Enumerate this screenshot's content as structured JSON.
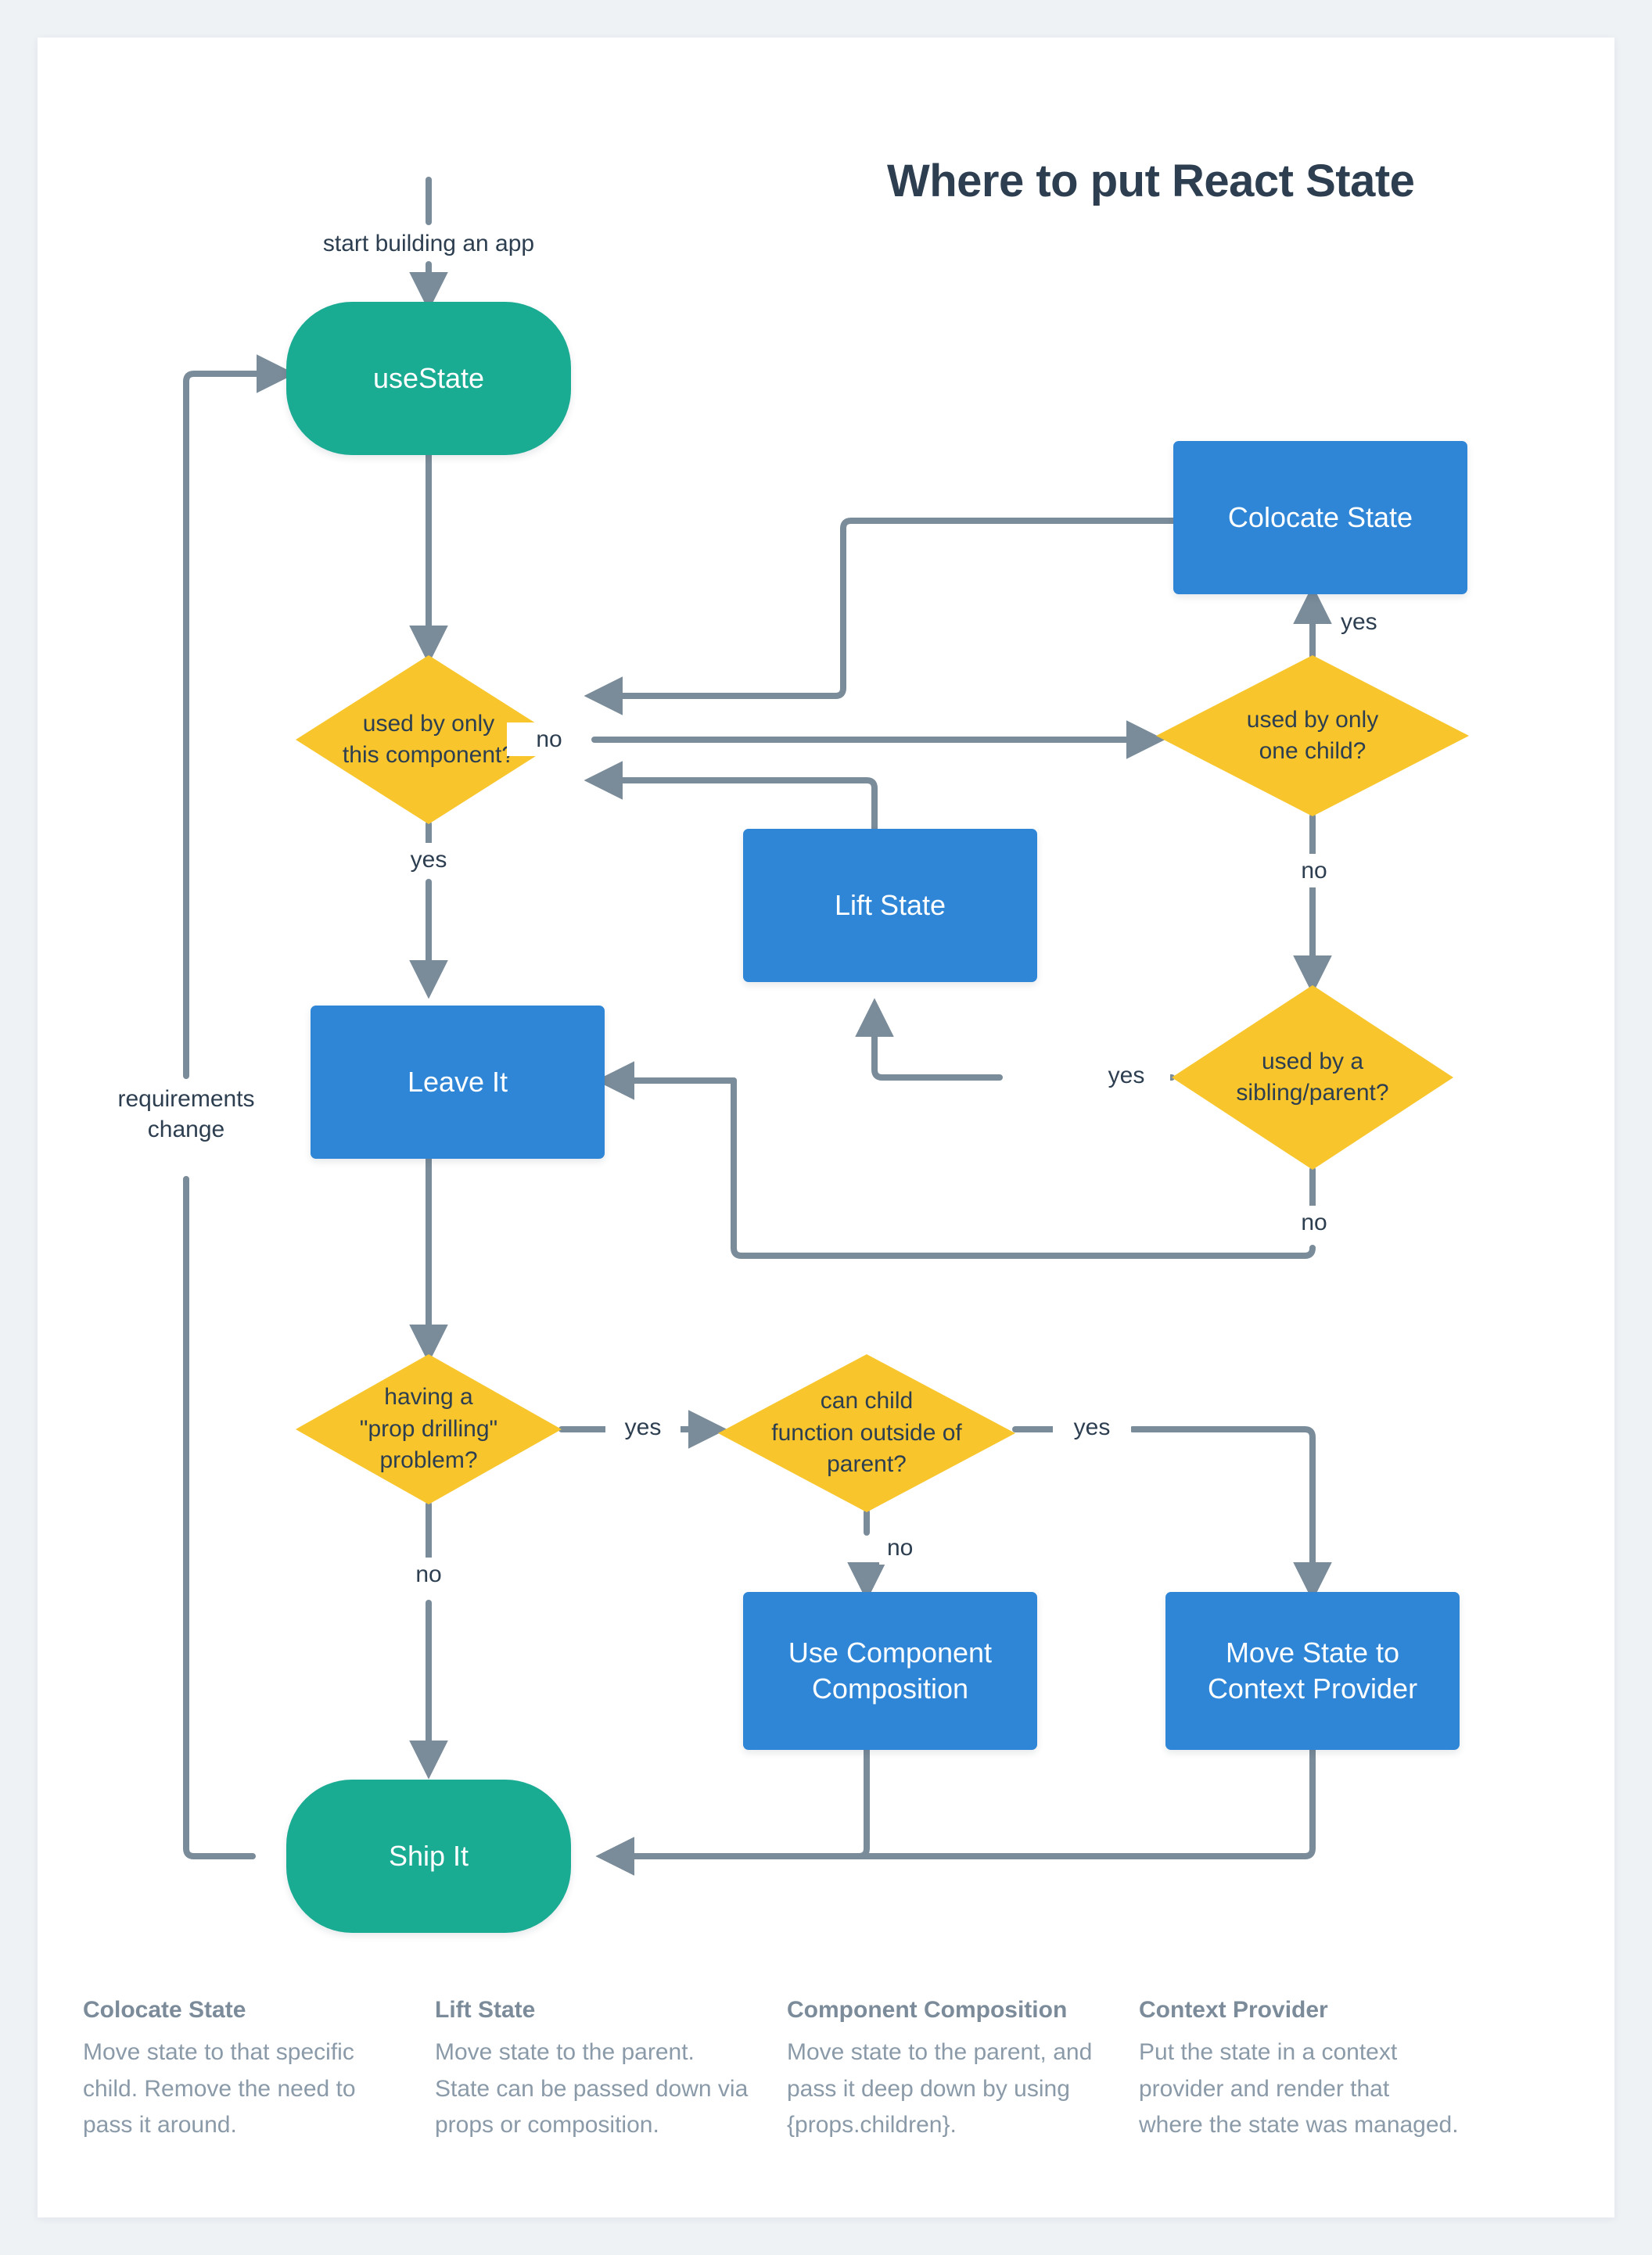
{
  "title": "Where to put React State",
  "colors": {
    "page_background": "#eef2f5",
    "card_background": "#ffffff",
    "terminal_teal": "#1aab93",
    "action_blue": "#2f86d7",
    "decision_yellow": "#f8c62c",
    "edge_gray": "#7a8b99",
    "text_dark": "#2c3e50",
    "legend_gray": "#8a9aa8"
  },
  "nodes": {
    "use_state": "useState",
    "colocate_state": "Colocate State",
    "lift_state": "Lift State",
    "leave_it": "Leave It",
    "use_component_composition": "Use Component\nComposition",
    "move_state_to_context_provider": "Move State to\nContext Provider",
    "ship_it": "Ship It"
  },
  "decisions": {
    "used_by_only_this_component": "used by only\nthis component?",
    "used_by_only_one_child": "used by only\none child?",
    "used_by_a_sibling_parent": "used by a\nsibling/parent?",
    "having_a_prop_drilling_problem": "having a\n\"prop drilling\"\nproblem?",
    "can_child_function_outside_of_parent": "can child\nfunction outside of\nparent?"
  },
  "edge_labels": {
    "start": "start building an app",
    "requirements_change": "requirements\nchange",
    "this_component_no": "no",
    "this_component_yes": "yes",
    "one_child_yes": "yes",
    "one_child_no": "no",
    "sibling_parent_yes": "yes",
    "sibling_parent_no": "no",
    "prop_drilling_yes": "yes",
    "prop_drilling_no": "no",
    "child_outside_yes": "yes",
    "child_outside_no": "no"
  },
  "legend": [
    {
      "title": "Colocate State",
      "body": "Move state to that specific child. Remove the need to pass it around."
    },
    {
      "title": "Lift State",
      "body": "Move state to the parent. State can be passed down via props or composition."
    },
    {
      "title": "Component Composition",
      "body": "Move state to the parent, and pass it deep down by using {props.children}."
    },
    {
      "title": "Context Provider",
      "body": "Put the state in a context provider and render that where the state was managed."
    }
  ],
  "chart_data": {
    "type": "flowchart",
    "title": "Where to put React State",
    "nodes": [
      {
        "id": "start",
        "label": "start building an app",
        "shape": "edge-label"
      },
      {
        "id": "useState",
        "label": "useState",
        "shape": "pill",
        "color": "#1aab93"
      },
      {
        "id": "q1",
        "label": "used by only this component?",
        "shape": "diamond",
        "color": "#f8c62c"
      },
      {
        "id": "q2",
        "label": "used by only one child?",
        "shape": "diamond",
        "color": "#f8c62c"
      },
      {
        "id": "colocate",
        "label": "Colocate State",
        "shape": "rect",
        "color": "#2f86d7"
      },
      {
        "id": "q3",
        "label": "used by a sibling/parent?",
        "shape": "diamond",
        "color": "#f8c62c"
      },
      {
        "id": "lift",
        "label": "Lift State",
        "shape": "rect",
        "color": "#2f86d7"
      },
      {
        "id": "leave",
        "label": "Leave It",
        "shape": "rect",
        "color": "#2f86d7"
      },
      {
        "id": "q4",
        "label": "having a \"prop drilling\" problem?",
        "shape": "diamond",
        "color": "#f8c62c"
      },
      {
        "id": "q5",
        "label": "can child function outside of parent?",
        "shape": "diamond",
        "color": "#f8c62c"
      },
      {
        "id": "composition",
        "label": "Use Component Composition",
        "shape": "rect",
        "color": "#2f86d7"
      },
      {
        "id": "context",
        "label": "Move State to Context Provider",
        "shape": "rect",
        "color": "#2f86d7"
      },
      {
        "id": "ship",
        "label": "Ship It",
        "shape": "pill",
        "color": "#1aab93"
      }
    ],
    "edges": [
      {
        "from": "start",
        "to": "useState",
        "label": ""
      },
      {
        "from": "useState",
        "to": "q1",
        "label": ""
      },
      {
        "from": "q1",
        "to": "q2",
        "label": "no"
      },
      {
        "from": "q1",
        "to": "leave",
        "label": "yes"
      },
      {
        "from": "q2",
        "to": "colocate",
        "label": "yes"
      },
      {
        "from": "q2",
        "to": "q3",
        "label": "no"
      },
      {
        "from": "colocate",
        "to": "q1",
        "label": ""
      },
      {
        "from": "q3",
        "to": "lift",
        "label": "yes"
      },
      {
        "from": "q3",
        "to": "leave",
        "label": "no"
      },
      {
        "from": "lift",
        "to": "q1",
        "label": ""
      },
      {
        "from": "leave",
        "to": "q4",
        "label": ""
      },
      {
        "from": "q4",
        "to": "q5",
        "label": "yes"
      },
      {
        "from": "q4",
        "to": "ship",
        "label": "no"
      },
      {
        "from": "q5",
        "to": "composition",
        "label": "no"
      },
      {
        "from": "q5",
        "to": "context",
        "label": "yes"
      },
      {
        "from": "composition",
        "to": "ship",
        "label": ""
      },
      {
        "from": "context",
        "to": "ship",
        "label": ""
      },
      {
        "from": "ship",
        "to": "useState",
        "label": "requirements change"
      }
    ]
  }
}
